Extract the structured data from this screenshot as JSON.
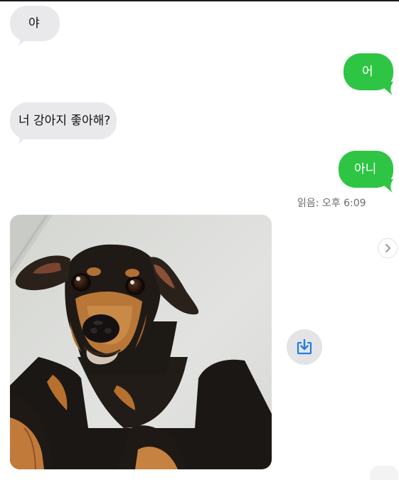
{
  "conversation": {
    "messages": [
      {
        "direction": "received",
        "text": "야"
      },
      {
        "direction": "sent",
        "text": "어"
      },
      {
        "direction": "received",
        "text": "너 강아지 좋아해?"
      },
      {
        "direction": "sent",
        "text": "아니"
      }
    ],
    "read_receipt": "읽음: 오후 6:09"
  },
  "photo_message": {
    "direction": "received",
    "subject": "dog-photo"
  },
  "icons": {
    "save": "download-to-tray-icon",
    "forward": "chevron-right-icon"
  },
  "colors": {
    "sent_bubble": "#2fc544",
    "received_bubble": "#e9e9eb",
    "accent_blue": "#1f7fe0"
  }
}
